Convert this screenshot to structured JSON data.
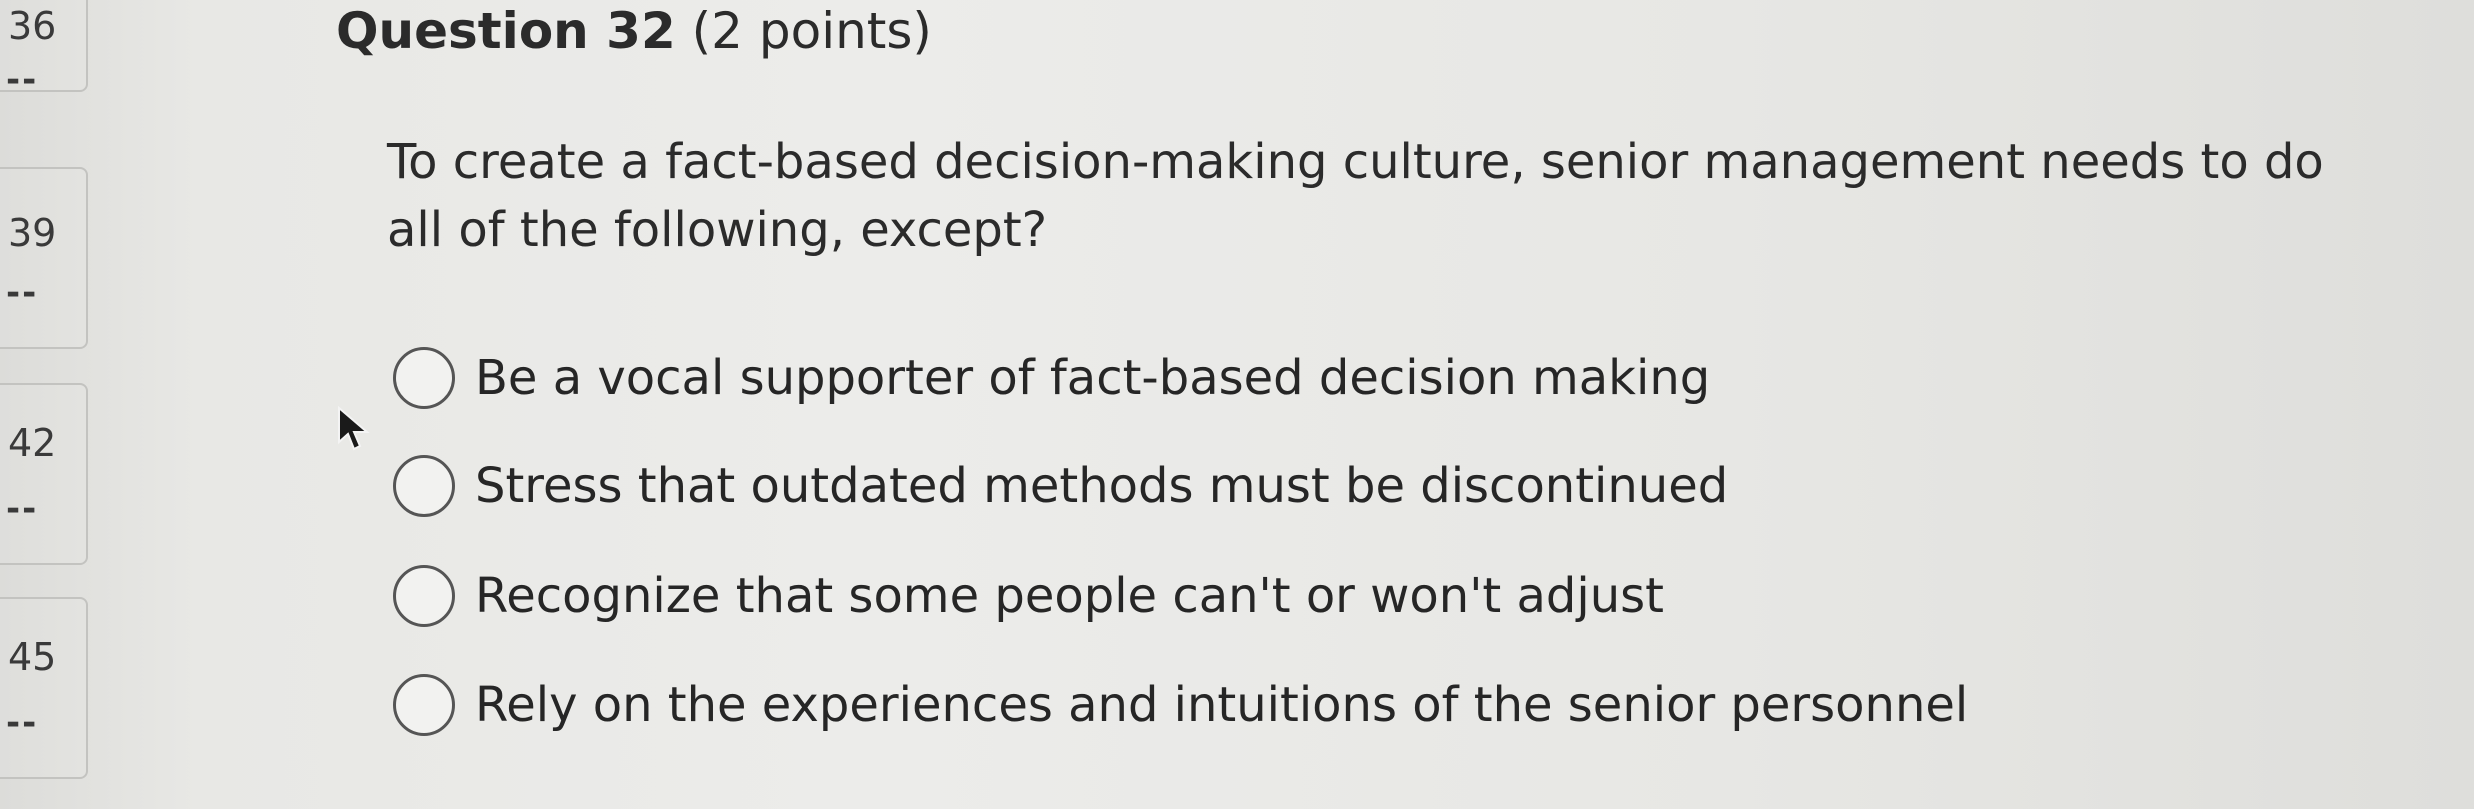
{
  "nav": [
    {
      "number": "36",
      "status": "--"
    },
    {
      "number": "39",
      "status": "--"
    },
    {
      "number": "42",
      "status": "--"
    },
    {
      "number": "45",
      "status": "--"
    }
  ],
  "question": {
    "title_main": "Question 32",
    "title_points": "(2 points)",
    "prompt": "To create a fact-based decision-making culture, senior management needs to do all of the following, except?",
    "options": [
      "Be a vocal supporter of fact-based decision making",
      "Stress that outdated methods must be discontinued",
      "Recognize that some people can't or won't adjust",
      "Rely on the experiences and intuitions of the senior personnel"
    ]
  },
  "icons": {
    "cursor": "mouse-pointer-icon",
    "radio": "radio-unselected-icon"
  }
}
